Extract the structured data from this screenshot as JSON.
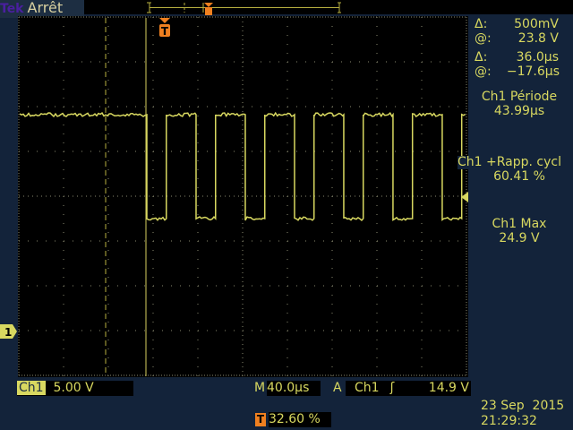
{
  "header": {
    "brand": "Tek",
    "status": "Arrêt"
  },
  "cursors": {
    "v_delta_label": "Δ:",
    "v_delta": "500mV",
    "v_at_label": "@:",
    "v_at": "23.8 V",
    "t_delta_label": "Δ:",
    "t_delta": "36.0µs",
    "t_at_label": "@:",
    "t_at": "−17.6µs"
  },
  "measurements": [
    {
      "label": "Ch1 Période",
      "value": "43.99µs"
    },
    {
      "label": "Ch1 +Rapp. cycl",
      "value": "60.41 %"
    },
    {
      "label": "Ch1 Max",
      "value": "24.9 V"
    }
  ],
  "bottom": {
    "channel": "Ch1",
    "scale": "5.00 V",
    "time_prefix": "M",
    "timebase": "40.0µs",
    "trig_prefix": "A",
    "trig_source": "Ch1",
    "trig_slope": "ʃ",
    "trig_level": "14.9 V",
    "trig_pos_icon": "T",
    "trig_pos": "32.60 %",
    "date": "23 Sep  2015",
    "time": "21:29:32"
  },
  "markers": {
    "trigger": "T",
    "ch1": "1"
  },
  "waveform": {
    "period_us": 43.99,
    "duty_pct": 60.41,
    "high_v": 24.9,
    "color": "#d8d860"
  }
}
